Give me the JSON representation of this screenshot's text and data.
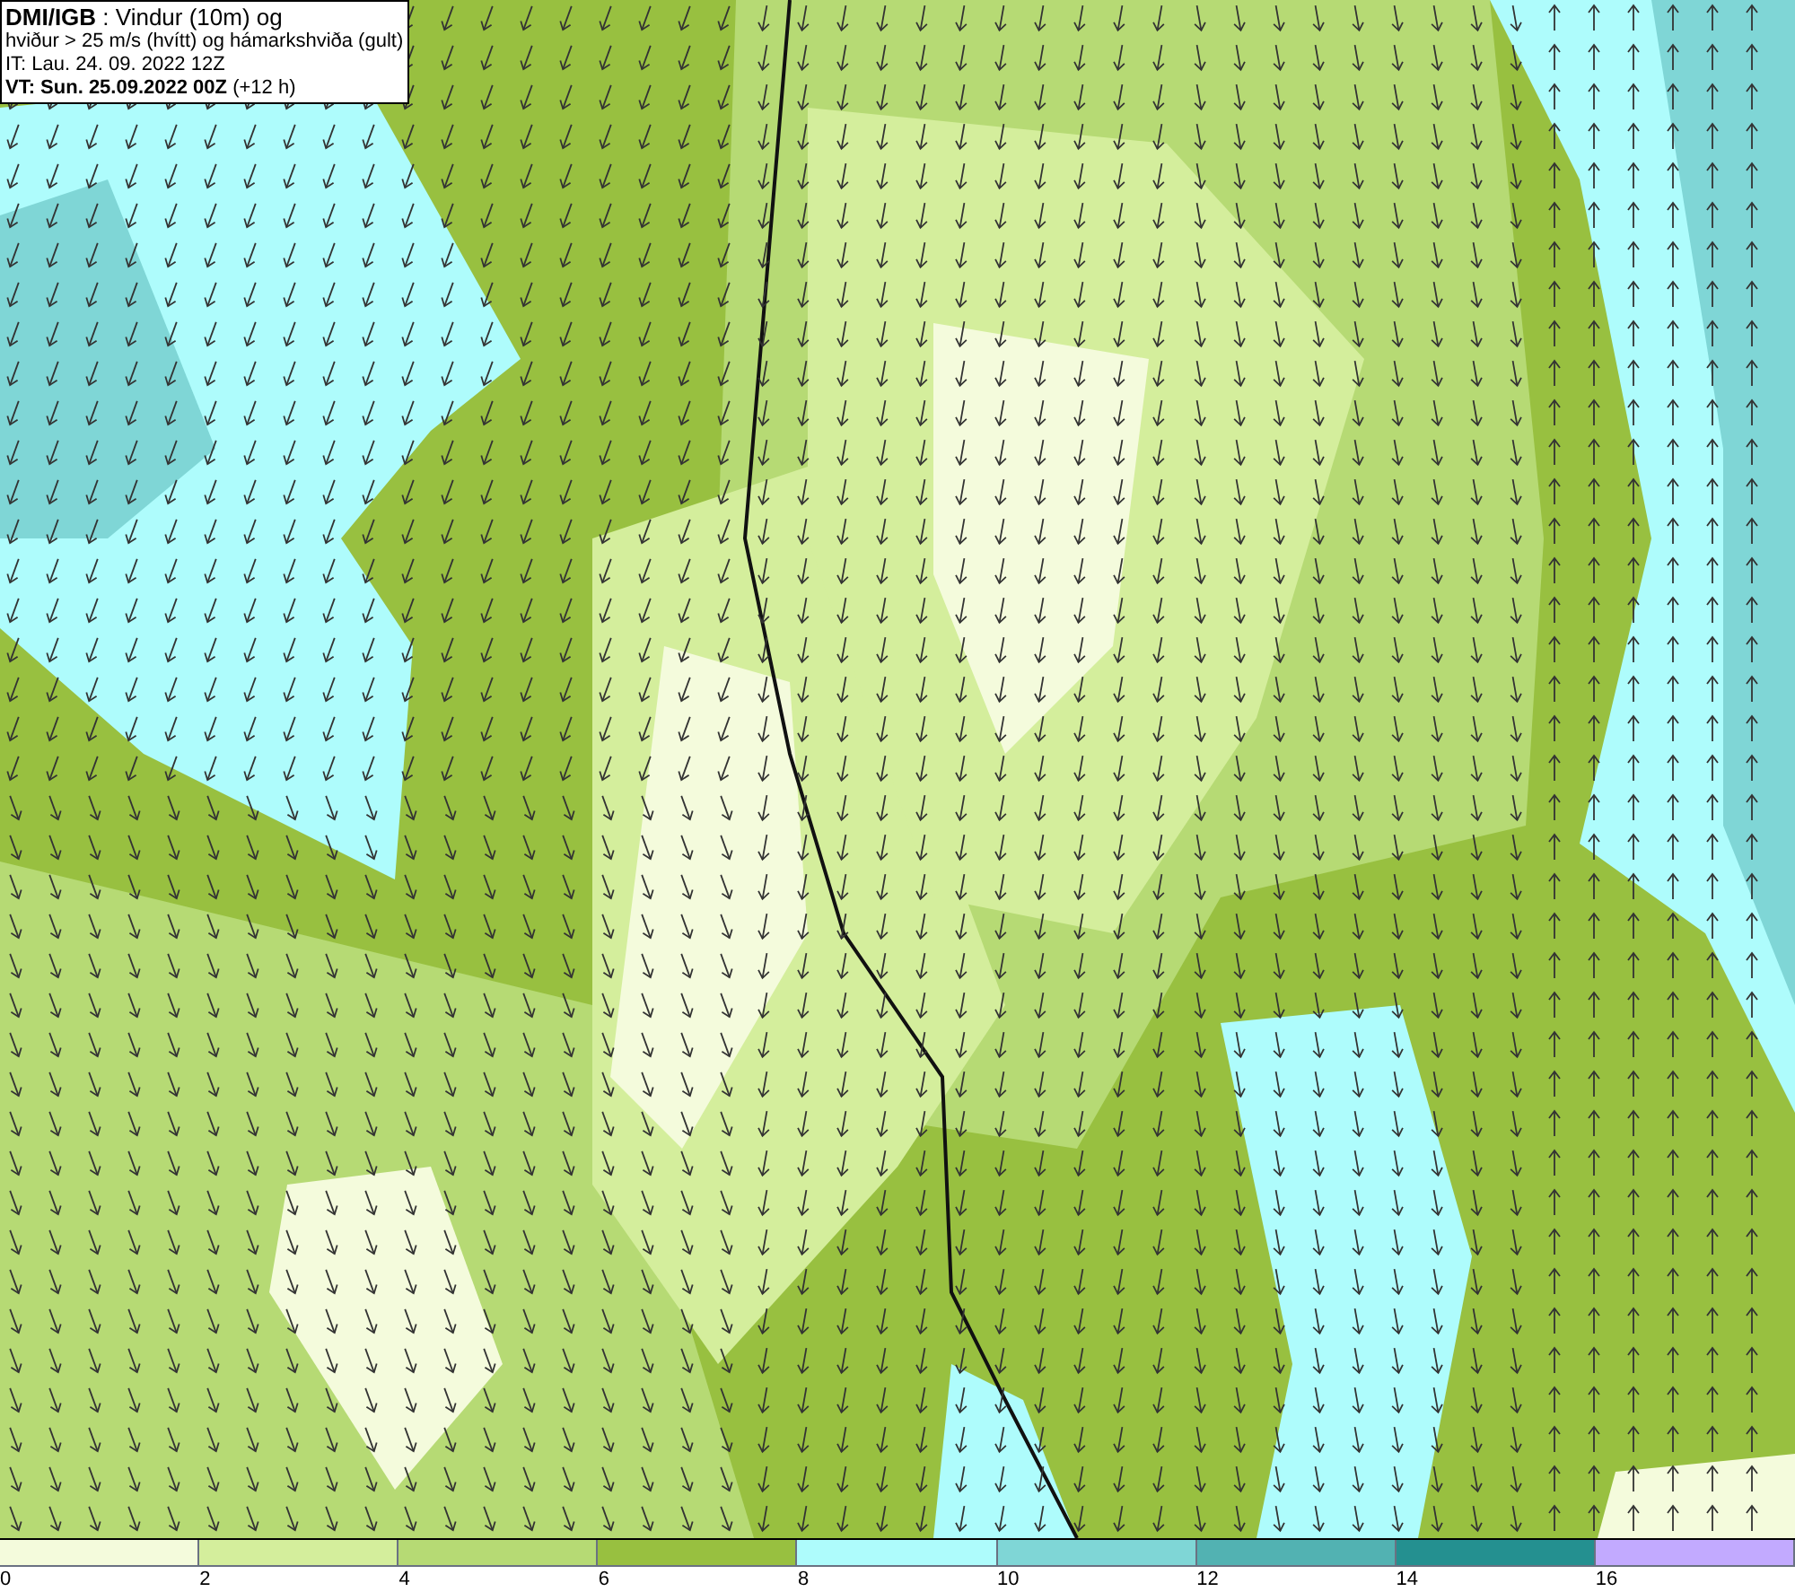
{
  "header": {
    "lines": [
      "**DMI/IGB** : Vindur (10m) og",
      "hviður > 25 m/s (hvítt) og hámarkshviða (gult)",
      "IT: Lau. 24. 09. 2022 12Z",
      "**VT: Sun. 25.09.2022 00Z** (+12 h)"
    ]
  },
  "legend": [
    {
      "label": "0",
      "color": "#f4fbdc"
    },
    {
      "label": "2",
      "color": "#d4ee9c"
    },
    {
      "label": "4",
      "color": "#b6da74"
    },
    {
      "label": "6",
      "color": "#98c040"
    },
    {
      "label": "8",
      "color": "#aefcfc"
    },
    {
      "label": "10",
      "color": "#7fd6d6"
    },
    {
      "label": "12",
      "color": "#52b2b2"
    },
    {
      "label": "14",
      "color": "#249090"
    },
    {
      "label": "16",
      "color": "#c2aaff"
    }
  ]
}
